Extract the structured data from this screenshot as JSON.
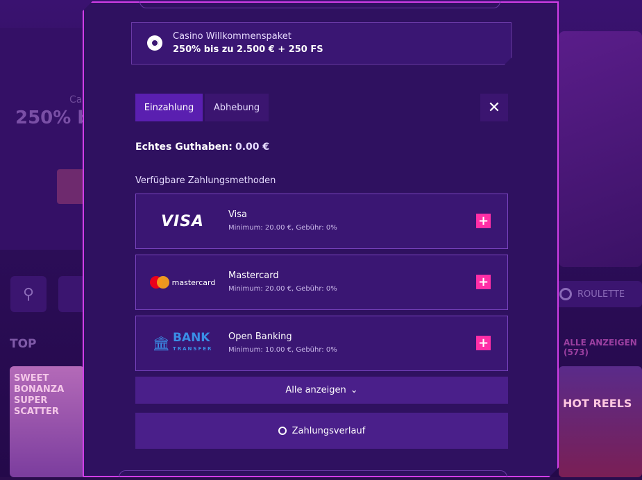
{
  "background": {
    "banner_title": "Ca",
    "banner_offer": "250% b",
    "section_top": "TOP",
    "roulette_label": "ROULETTE",
    "show_all_games": "ALLE ANZEIGEN (573)",
    "game1_title": "SWEET BONANZA SUPER SCATTER",
    "game2_title": "HOT REELS"
  },
  "promo": {
    "title": "Casino Willkommenspaket",
    "offer": "250% bis zu 2.500 € + 250 FS"
  },
  "tabs": [
    {
      "label": "Einzahlung",
      "active": true
    },
    {
      "label": "Abhebung",
      "active": false
    }
  ],
  "balance": {
    "label": "Echtes Guthaben:",
    "value": "0.00 €"
  },
  "methods_label": "Verfügbare Zahlungsmethoden",
  "methods": [
    {
      "name": "Visa",
      "info": "Minimum: 20.00 €, Gebühr: 0%",
      "logo_text": "VISA"
    },
    {
      "name": "Mastercard",
      "info": "Minimum: 20.00 €, Gebühr: 0%",
      "logo_text": "mastercard"
    },
    {
      "name": "Open Banking",
      "info": "Minimum: 10.00 €, Gebühr: 0%",
      "logo_text": "BANK",
      "logo_sub": "TRANSFER"
    }
  ],
  "show_all": "Alle anzeigen",
  "history": "Zahlungsverlauf",
  "colors": {
    "accent_pink": "#ff2ea6",
    "modal_border": "#d23ee8",
    "tab_active": "#5a1fb0"
  }
}
